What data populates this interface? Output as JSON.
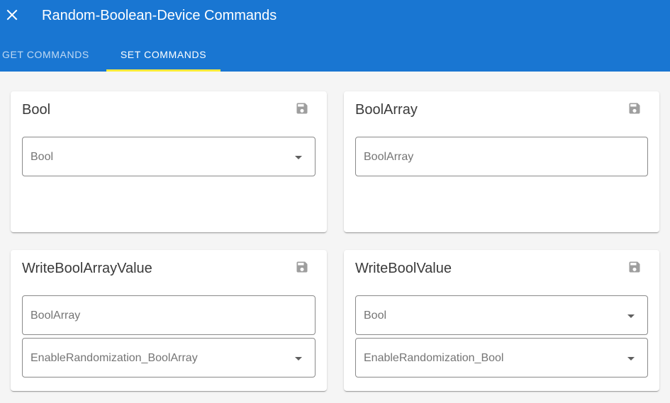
{
  "header": {
    "title": "Random-Boolean-Device Commands",
    "close_icon": "close-icon",
    "tabs": [
      {
        "label": "GET COMMANDS",
        "active": false
      },
      {
        "label": "SET COMMANDS",
        "active": true
      }
    ]
  },
  "colors": {
    "appbar": "#1976d2",
    "tab_indicator": "#ffeb3b",
    "icon_gray": "#9e9e9e"
  },
  "cards": [
    {
      "title": "Bool",
      "save_icon": "save-icon",
      "fields": [
        {
          "label": "Bool",
          "type": "select"
        }
      ]
    },
    {
      "title": "BoolArray",
      "save_icon": "save-icon",
      "fields": [
        {
          "label": "BoolArray",
          "type": "text"
        }
      ]
    },
    {
      "title": "WriteBoolArrayValue",
      "save_icon": "save-icon",
      "fields": [
        {
          "label": "BoolArray",
          "type": "text"
        },
        {
          "label": "EnableRandomization_BoolArray",
          "type": "select"
        }
      ]
    },
    {
      "title": "WriteBoolValue",
      "save_icon": "save-icon",
      "fields": [
        {
          "label": "Bool",
          "type": "select"
        },
        {
          "label": "EnableRandomization_Bool",
          "type": "select"
        }
      ]
    }
  ]
}
